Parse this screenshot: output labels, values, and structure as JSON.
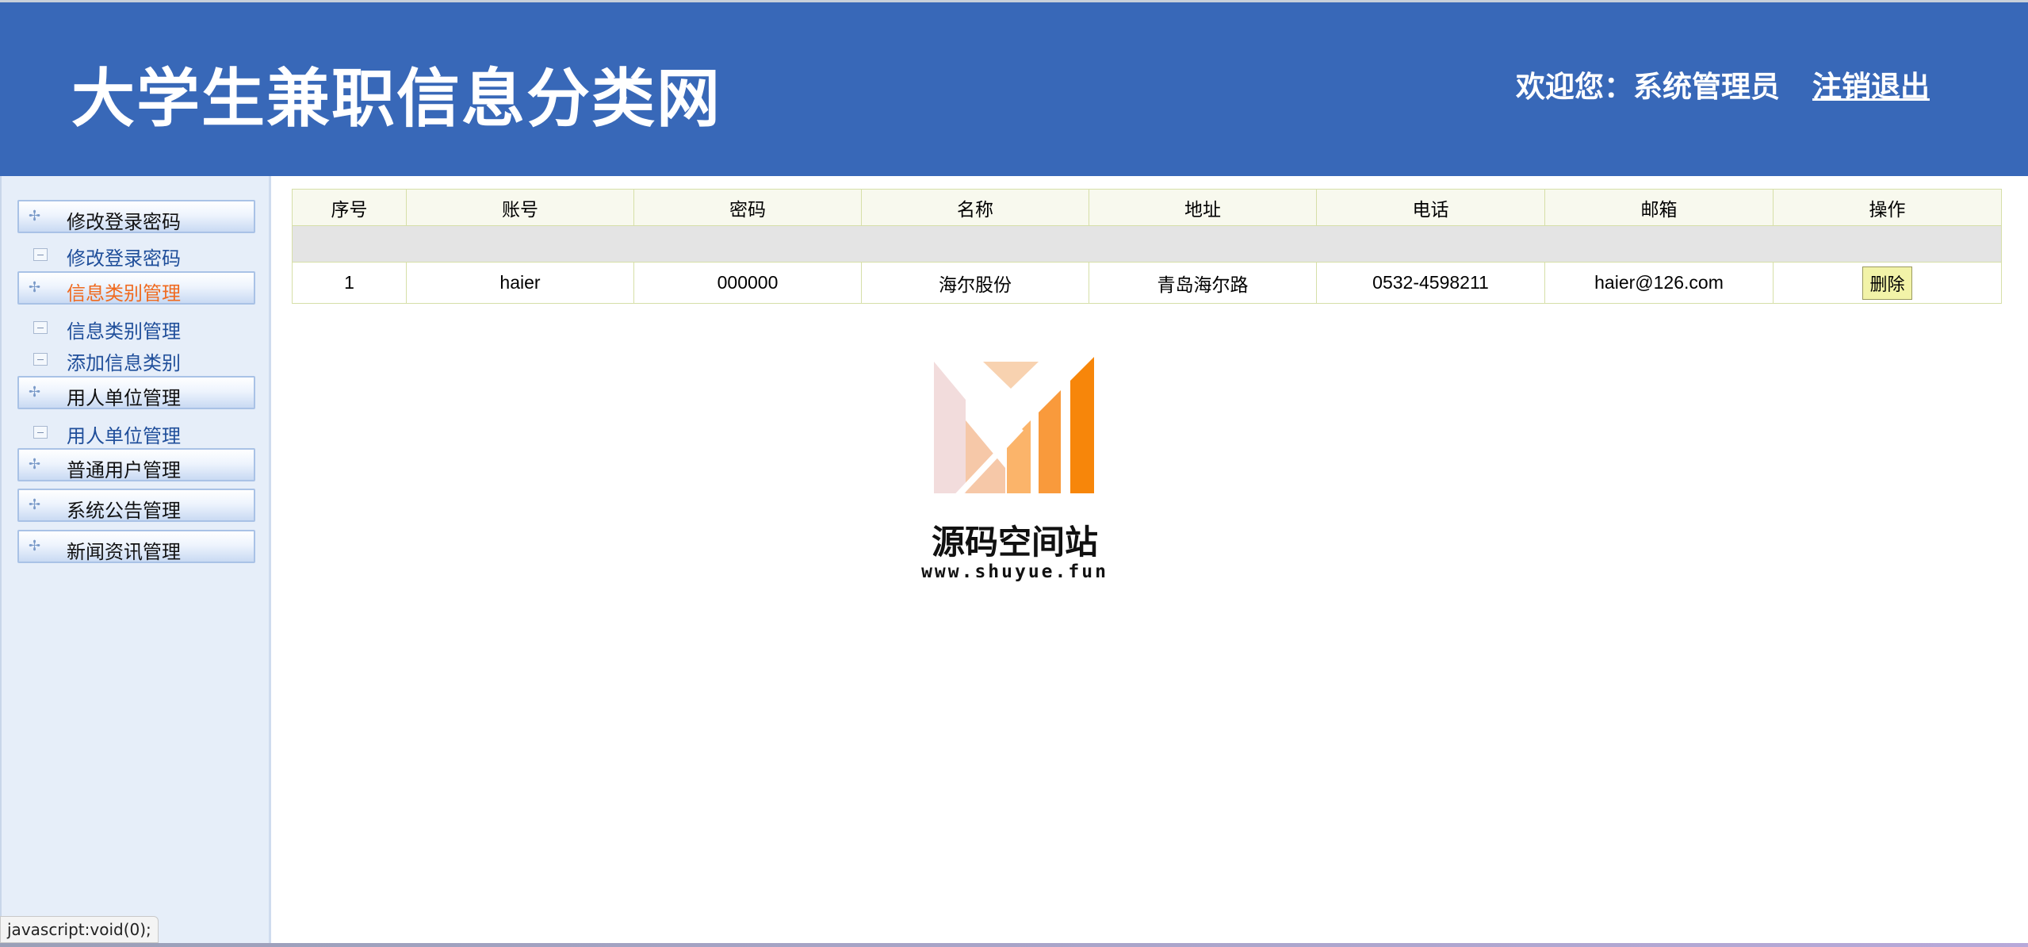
{
  "header": {
    "site_title": "大学生兼职信息分类网",
    "welcome": "欢迎您：系统管理员",
    "logout": "注销退出"
  },
  "sidebar": {
    "menus": [
      {
        "label": "修改登录密码",
        "active": false,
        "items": [
          "修改登录密码"
        ]
      },
      {
        "label": "信息类别管理",
        "active": true,
        "items": [
          "信息类别管理",
          "添加信息类别"
        ]
      },
      {
        "label": "用人单位管理",
        "active": false,
        "items": [
          "用人单位管理"
        ]
      },
      {
        "label": "普通用户管理",
        "active": false,
        "items": []
      },
      {
        "label": "系统公告管理",
        "active": false,
        "items": []
      },
      {
        "label": "新闻资讯管理",
        "active": false,
        "items": []
      }
    ]
  },
  "table": {
    "columns": [
      "序号",
      "账号",
      "密码",
      "名称",
      "地址",
      "电话",
      "邮箱",
      "操作"
    ],
    "rows": [
      {
        "index": "1",
        "account": "haier",
        "password": "000000",
        "name": "海尔股份",
        "address": "青岛海尔路",
        "phone": "0532-4598211",
        "email": "haier@126.com",
        "action": "删除"
      }
    ]
  },
  "watermark": {
    "name": "源码空间站",
    "url": "www.shuyue.fun"
  },
  "statusbar": {
    "text": "javascript:void(0);"
  },
  "colors": {
    "header_bg": "#3868b8",
    "sidebar_bg": "#e6eef9",
    "active_menu": "#f06a1f",
    "sub_menu": "#1f4e9a",
    "delete_button": "#f2f3a8"
  }
}
